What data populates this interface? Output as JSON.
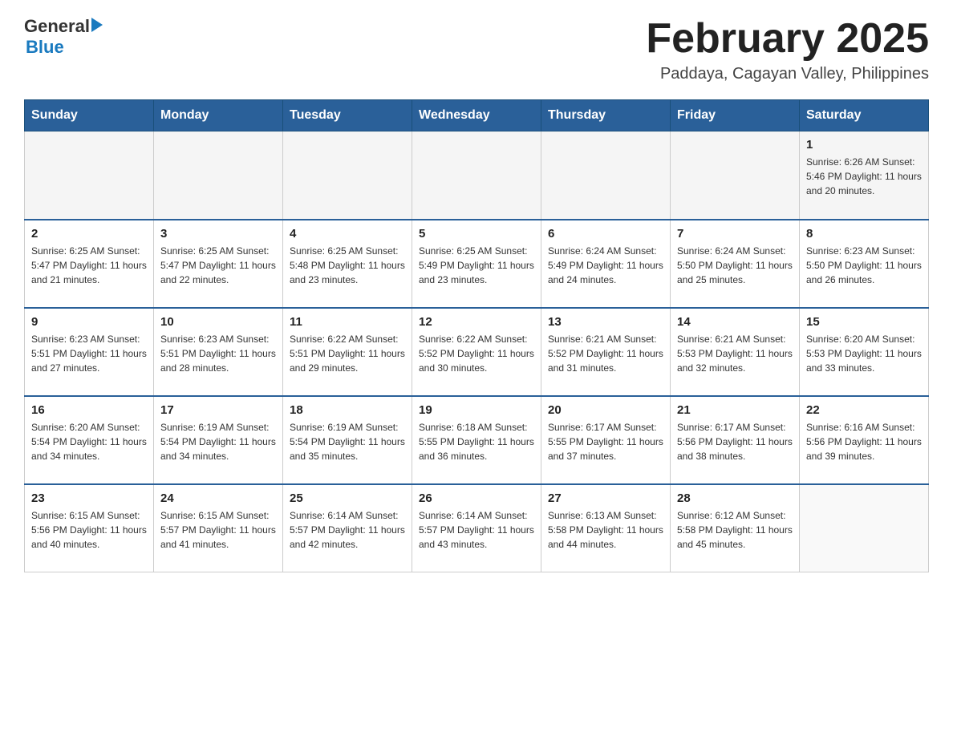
{
  "header": {
    "logo": {
      "general": "General",
      "blue": "Blue",
      "arrow": "▶"
    },
    "title": "February 2025",
    "subtitle": "Paddaya, Cagayan Valley, Philippines"
  },
  "days_of_week": [
    "Sunday",
    "Monday",
    "Tuesday",
    "Wednesday",
    "Thursday",
    "Friday",
    "Saturday"
  ],
  "weeks": [
    {
      "days": [
        {
          "number": "",
          "info": ""
        },
        {
          "number": "",
          "info": ""
        },
        {
          "number": "",
          "info": ""
        },
        {
          "number": "",
          "info": ""
        },
        {
          "number": "",
          "info": ""
        },
        {
          "number": "",
          "info": ""
        },
        {
          "number": "1",
          "info": "Sunrise: 6:26 AM\nSunset: 5:46 PM\nDaylight: 11 hours and 20 minutes."
        }
      ]
    },
    {
      "days": [
        {
          "number": "2",
          "info": "Sunrise: 6:25 AM\nSunset: 5:47 PM\nDaylight: 11 hours and 21 minutes."
        },
        {
          "number": "3",
          "info": "Sunrise: 6:25 AM\nSunset: 5:47 PM\nDaylight: 11 hours and 22 minutes."
        },
        {
          "number": "4",
          "info": "Sunrise: 6:25 AM\nSunset: 5:48 PM\nDaylight: 11 hours and 23 minutes."
        },
        {
          "number": "5",
          "info": "Sunrise: 6:25 AM\nSunset: 5:49 PM\nDaylight: 11 hours and 23 minutes."
        },
        {
          "number": "6",
          "info": "Sunrise: 6:24 AM\nSunset: 5:49 PM\nDaylight: 11 hours and 24 minutes."
        },
        {
          "number": "7",
          "info": "Sunrise: 6:24 AM\nSunset: 5:50 PM\nDaylight: 11 hours and 25 minutes."
        },
        {
          "number": "8",
          "info": "Sunrise: 6:23 AM\nSunset: 5:50 PM\nDaylight: 11 hours and 26 minutes."
        }
      ]
    },
    {
      "days": [
        {
          "number": "9",
          "info": "Sunrise: 6:23 AM\nSunset: 5:51 PM\nDaylight: 11 hours and 27 minutes."
        },
        {
          "number": "10",
          "info": "Sunrise: 6:23 AM\nSunset: 5:51 PM\nDaylight: 11 hours and 28 minutes."
        },
        {
          "number": "11",
          "info": "Sunrise: 6:22 AM\nSunset: 5:51 PM\nDaylight: 11 hours and 29 minutes."
        },
        {
          "number": "12",
          "info": "Sunrise: 6:22 AM\nSunset: 5:52 PM\nDaylight: 11 hours and 30 minutes."
        },
        {
          "number": "13",
          "info": "Sunrise: 6:21 AM\nSunset: 5:52 PM\nDaylight: 11 hours and 31 minutes."
        },
        {
          "number": "14",
          "info": "Sunrise: 6:21 AM\nSunset: 5:53 PM\nDaylight: 11 hours and 32 minutes."
        },
        {
          "number": "15",
          "info": "Sunrise: 6:20 AM\nSunset: 5:53 PM\nDaylight: 11 hours and 33 minutes."
        }
      ]
    },
    {
      "days": [
        {
          "number": "16",
          "info": "Sunrise: 6:20 AM\nSunset: 5:54 PM\nDaylight: 11 hours and 34 minutes."
        },
        {
          "number": "17",
          "info": "Sunrise: 6:19 AM\nSunset: 5:54 PM\nDaylight: 11 hours and 34 minutes."
        },
        {
          "number": "18",
          "info": "Sunrise: 6:19 AM\nSunset: 5:54 PM\nDaylight: 11 hours and 35 minutes."
        },
        {
          "number": "19",
          "info": "Sunrise: 6:18 AM\nSunset: 5:55 PM\nDaylight: 11 hours and 36 minutes."
        },
        {
          "number": "20",
          "info": "Sunrise: 6:17 AM\nSunset: 5:55 PM\nDaylight: 11 hours and 37 minutes."
        },
        {
          "number": "21",
          "info": "Sunrise: 6:17 AM\nSunset: 5:56 PM\nDaylight: 11 hours and 38 minutes."
        },
        {
          "number": "22",
          "info": "Sunrise: 6:16 AM\nSunset: 5:56 PM\nDaylight: 11 hours and 39 minutes."
        }
      ]
    },
    {
      "days": [
        {
          "number": "23",
          "info": "Sunrise: 6:15 AM\nSunset: 5:56 PM\nDaylight: 11 hours and 40 minutes."
        },
        {
          "number": "24",
          "info": "Sunrise: 6:15 AM\nSunset: 5:57 PM\nDaylight: 11 hours and 41 minutes."
        },
        {
          "number": "25",
          "info": "Sunrise: 6:14 AM\nSunset: 5:57 PM\nDaylight: 11 hours and 42 minutes."
        },
        {
          "number": "26",
          "info": "Sunrise: 6:14 AM\nSunset: 5:57 PM\nDaylight: 11 hours and 43 minutes."
        },
        {
          "number": "27",
          "info": "Sunrise: 6:13 AM\nSunset: 5:58 PM\nDaylight: 11 hours and 44 minutes."
        },
        {
          "number": "28",
          "info": "Sunrise: 6:12 AM\nSunset: 5:58 PM\nDaylight: 11 hours and 45 minutes."
        },
        {
          "number": "",
          "info": ""
        }
      ]
    }
  ]
}
